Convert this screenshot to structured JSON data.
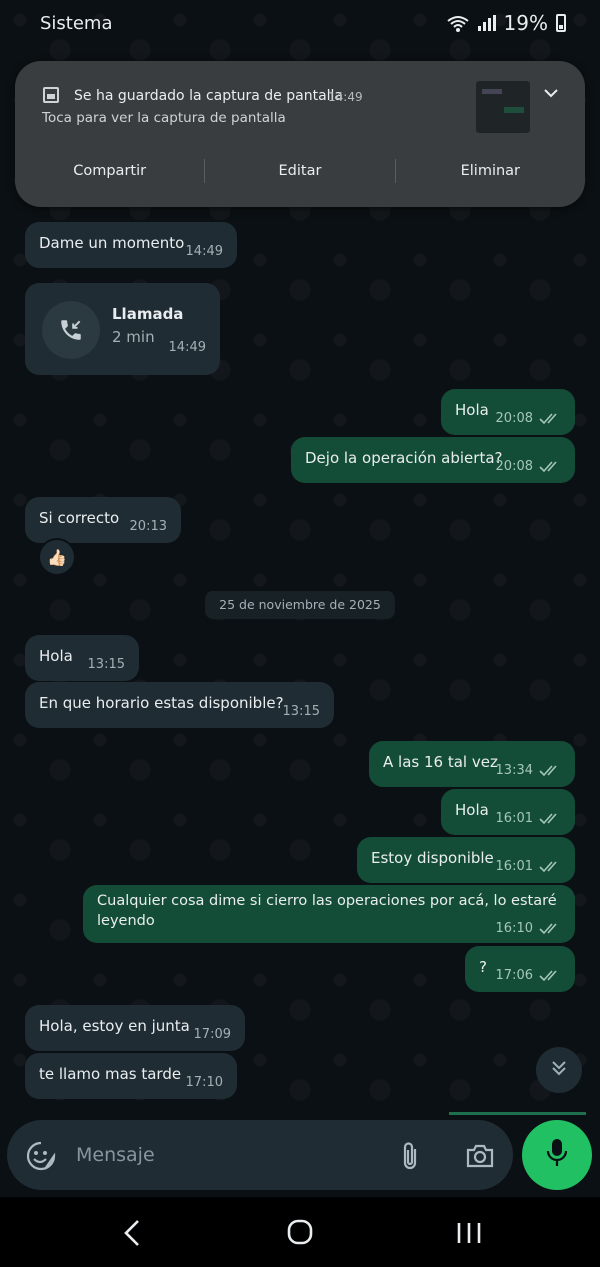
{
  "status_bar": {
    "carrier": "Sistema",
    "battery": "19%"
  },
  "notification": {
    "title": "Se ha guardado la captura de pantalla",
    "time": "14:49",
    "subtitle": "Toca para ver la captura de pantalla",
    "actions": [
      "Compartir",
      "Editar",
      "Eliminar"
    ]
  },
  "messages": {
    "m1": {
      "text": "Dame un momento",
      "time": "14:49"
    },
    "call": {
      "title": "Llamada",
      "duration": "2 min",
      "time": "14:49"
    },
    "m2": {
      "text": "Hola",
      "time": "20:08"
    },
    "m3": {
      "text": "Dejo la operación abierta?",
      "time": "20:08"
    },
    "m4": {
      "text": "Si correcto",
      "time": "20:13",
      "reaction": "👍🏻"
    },
    "date_chip": "25 de noviembre de 2025",
    "m5": {
      "text": "Hola",
      "time": "13:15"
    },
    "m6": {
      "text": "En que horario estas disponible?",
      "time": "13:15"
    },
    "m7": {
      "text": "A las 16 tal vez",
      "time": "13:34"
    },
    "m8": {
      "text": "Hola",
      "time": "16:01"
    },
    "m9": {
      "text": "Estoy disponible",
      "time": "16:01"
    },
    "m10": {
      "line1": "Cualquier cosa dime si cierro las operaciones por acá, lo estaré",
      "line2": "leyendo",
      "time": "16:10"
    },
    "m11": {
      "text": "?",
      "time": "17:06"
    },
    "m12": {
      "text": "Hola, estoy en junta",
      "time": "17:09"
    },
    "m13": {
      "text": "te llamo mas tarde",
      "time": "17:10"
    }
  },
  "composer": {
    "placeholder": "Mensaje"
  },
  "colors": {
    "outgoing": "#144d37",
    "incoming": "#1f2c33",
    "accent": "#21c063",
    "ticks": "#a4c7b8"
  },
  "icons": [
    "wifi-icon",
    "signal-icon",
    "battery-icon",
    "image-icon",
    "chevron-down-icon",
    "call-received-icon",
    "double-check-icon",
    "scroll-down-icon",
    "sticker-icon",
    "attach-icon",
    "camera-icon",
    "mic-icon",
    "nav-back-icon",
    "nav-home-icon",
    "nav-recents-icon"
  ]
}
